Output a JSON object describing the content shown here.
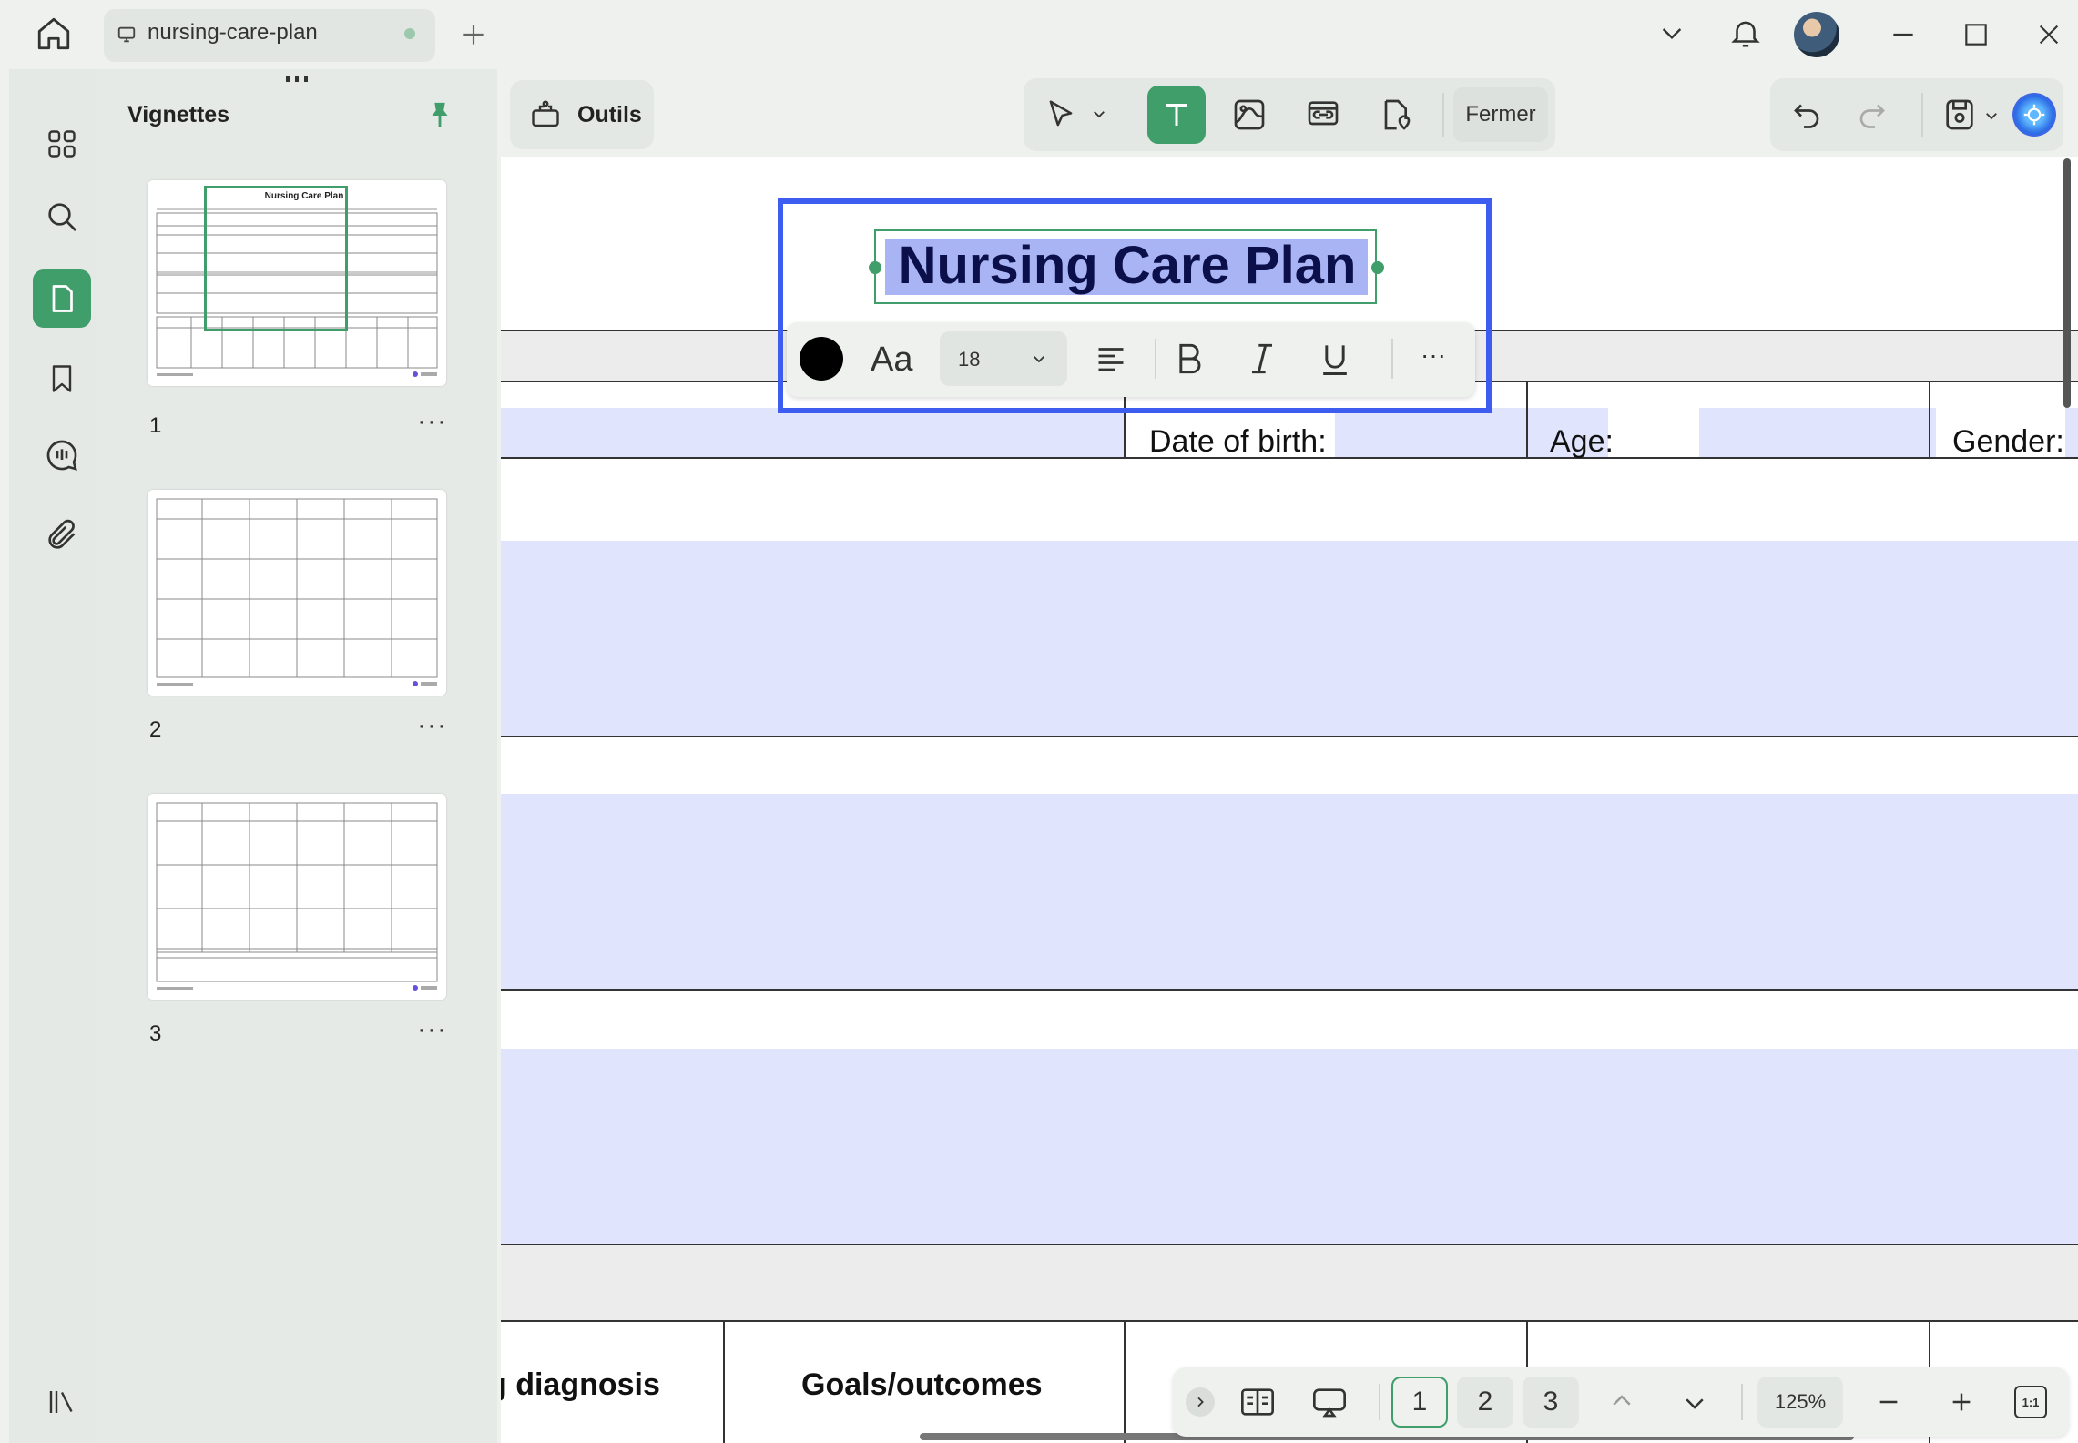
{
  "window": {
    "tab_title": "nursing-care-plan"
  },
  "sidebar": {
    "panel_title": "Vignettes",
    "items": [
      "grid-icon",
      "search-icon",
      "pages-icon",
      "bookmark-icon",
      "comment-icon",
      "attachment-icon"
    ],
    "pages": [
      {
        "number": "1",
        "thumb_title": "Nursing Care Plan"
      },
      {
        "number": "2"
      },
      {
        "number": "3"
      }
    ],
    "more_label": "···"
  },
  "toolbar": {
    "tools_label": "Outils",
    "close_label": "Fermer"
  },
  "text_format": {
    "font_label": "Aa",
    "font_size": "18",
    "more_label": "···",
    "color": "#000000"
  },
  "document": {
    "title": "Nursing Care Plan",
    "fields": {
      "dob_label": "Date of birth:",
      "age_label": "Age:",
      "gender_label": "Gender:"
    },
    "table_headers": {
      "diagnosis": "g diagnosis",
      "goals": "Goals/outcomes"
    }
  },
  "navigation": {
    "pages": [
      "1",
      "2",
      "3"
    ],
    "current_page": "1",
    "zoom": "125%",
    "fit_label": "1:1"
  },
  "colors": {
    "accent": "#3f9e6a",
    "selection": "#3d5cf0",
    "field_fill": "#e0e4fc"
  }
}
